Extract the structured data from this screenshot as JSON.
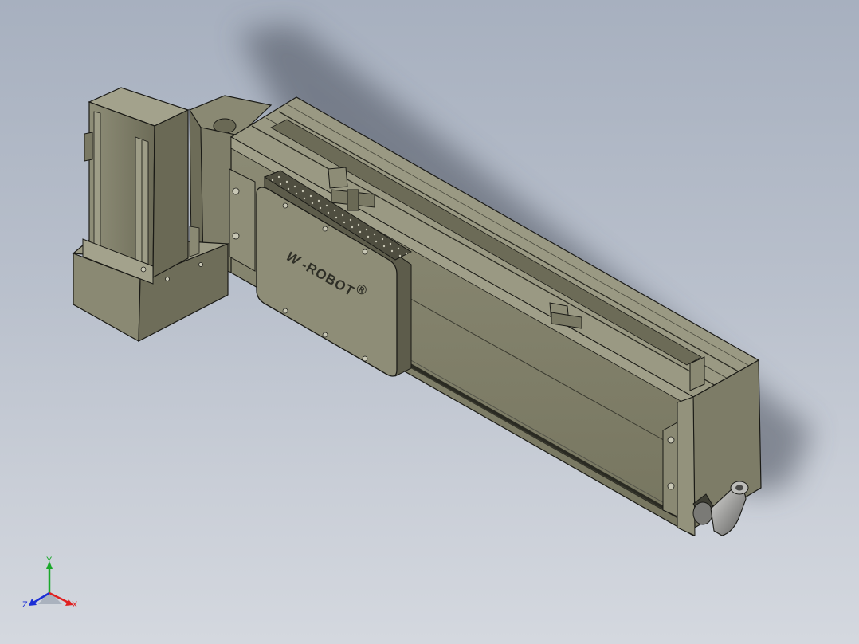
{
  "model": {
    "brand_logo": "W",
    "brand_label": "-ROBOT",
    "brand_mark": "®",
    "parts": {
      "motor": "servo-motor",
      "gearbox": "motor-mount-block",
      "rail": "linear-rail-body",
      "carriage": "slider-carriage",
      "end_cap": "end-cap",
      "fitting": "elbow-fitting"
    }
  },
  "triad": {
    "x_label": "X",
    "y_label": "Y",
    "z_label": "Z",
    "x_color": "#e02020",
    "y_color": "#1aa82a",
    "z_color": "#1c2fd6"
  },
  "colors": {
    "body": "#85846f",
    "body_dark": "#5f5e4e",
    "body_light": "#a3a28c",
    "outline": "#1a1a16"
  }
}
